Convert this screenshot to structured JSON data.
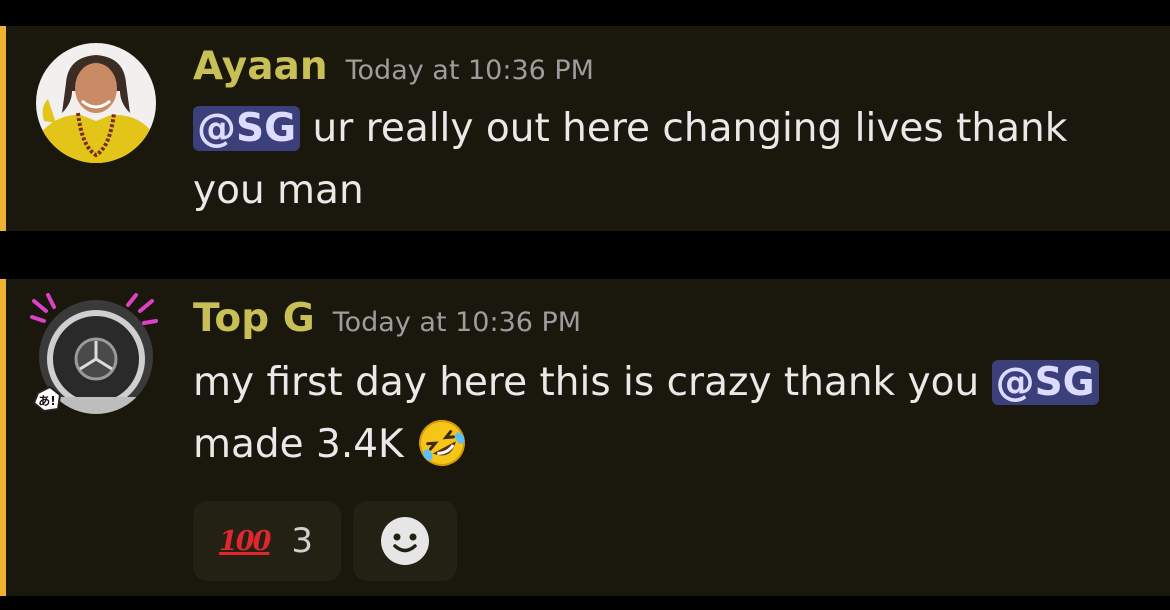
{
  "messages": [
    {
      "username": "Ayaan",
      "timestamp": "Today at 10:36 PM",
      "mention": "@SG",
      "text_after_mention": " ur really out here changing lives thank you man"
    },
    {
      "username": "Top G",
      "timestamp": "Today at 10:36 PM",
      "text_before_mention": "my first day here this is crazy thank you ",
      "mention": "@SG",
      "text_after_mention": " made 3.4K ",
      "emoji": "🤣"
    }
  ],
  "reactions": [
    {
      "emoji": "100",
      "count": "3"
    },
    {
      "icon": "add-reaction-icon"
    }
  ],
  "colors": {
    "accent": "#f0b232",
    "username": "#c9bf57",
    "mention_bg": "#3b3f7a",
    "background": "#1a170c"
  }
}
